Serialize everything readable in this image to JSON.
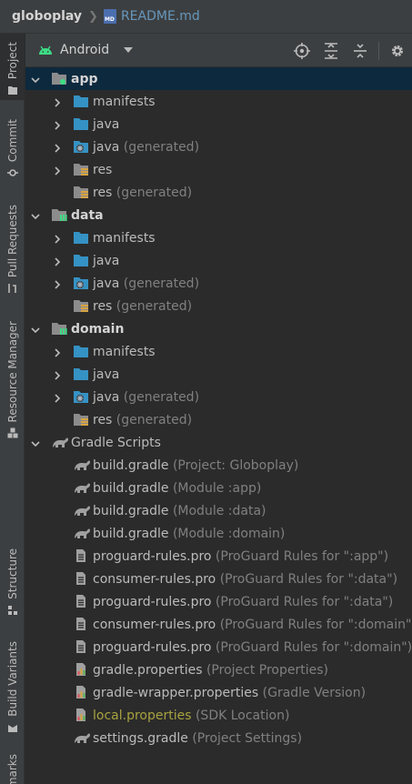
{
  "breadcrumb": {
    "project": "globoplay",
    "file": "README.md"
  },
  "left_tabs": [
    {
      "label": "Project"
    },
    {
      "label": "Commit"
    },
    {
      "label": "Pull Requests"
    },
    {
      "label": "Resource Manager"
    },
    {
      "label": "Structure"
    },
    {
      "label": "Build Variants"
    },
    {
      "label": "Bookmarks"
    }
  ],
  "panel": {
    "view_mode": "Android"
  },
  "tree": [
    {
      "label": "app",
      "hint": "",
      "level": 0,
      "expanded": true,
      "icon": "module-app-icon",
      "selected": true
    },
    {
      "label": "manifests",
      "hint": "",
      "level": 1,
      "expanded": false,
      "icon": "folder-icon"
    },
    {
      "label": "java",
      "hint": "",
      "level": 1,
      "expanded": false,
      "icon": "folder-icon"
    },
    {
      "label": "java",
      "hint": " (generated)",
      "level": 1,
      "expanded": false,
      "icon": "generated-folder-icon"
    },
    {
      "label": "res",
      "hint": "",
      "level": 1,
      "expanded": false,
      "icon": "res-folder-icon"
    },
    {
      "label": "res",
      "hint": " (generated)",
      "level": 1,
      "expanded": null,
      "icon": "res-folder-icon"
    },
    {
      "label": "data",
      "hint": "",
      "level": 0,
      "expanded": true,
      "icon": "module-lib-icon"
    },
    {
      "label": "manifests",
      "hint": "",
      "level": 1,
      "expanded": false,
      "icon": "folder-icon"
    },
    {
      "label": "java",
      "hint": "",
      "level": 1,
      "expanded": false,
      "icon": "folder-icon"
    },
    {
      "label": "java",
      "hint": " (generated)",
      "level": 1,
      "expanded": false,
      "icon": "generated-folder-icon"
    },
    {
      "label": "res",
      "hint": " (generated)",
      "level": 1,
      "expanded": null,
      "icon": "res-folder-icon"
    },
    {
      "label": "domain",
      "hint": "",
      "level": 0,
      "expanded": true,
      "icon": "module-lib-icon"
    },
    {
      "label": "manifests",
      "hint": "",
      "level": 1,
      "expanded": false,
      "icon": "folder-icon"
    },
    {
      "label": "java",
      "hint": "",
      "level": 1,
      "expanded": false,
      "icon": "folder-icon"
    },
    {
      "label": "java",
      "hint": " (generated)",
      "level": 1,
      "expanded": false,
      "icon": "generated-folder-icon"
    },
    {
      "label": "res",
      "hint": " (generated)",
      "level": 1,
      "expanded": null,
      "icon": "res-folder-icon"
    },
    {
      "label": "Gradle Scripts",
      "hint": "",
      "level": 0,
      "expanded": true,
      "icon": "gradle-icon",
      "plain": true
    },
    {
      "label": "build.gradle",
      "hint": " (Project: Globoplay)",
      "level": 1,
      "expanded": null,
      "icon": "gradle-icon"
    },
    {
      "label": "build.gradle",
      "hint": " (Module :app)",
      "level": 1,
      "expanded": null,
      "icon": "gradle-icon"
    },
    {
      "label": "build.gradle",
      "hint": " (Module :data)",
      "level": 1,
      "expanded": null,
      "icon": "gradle-icon"
    },
    {
      "label": "build.gradle",
      "hint": " (Module :domain)",
      "level": 1,
      "expanded": null,
      "icon": "gradle-icon"
    },
    {
      "label": "proguard-rules.pro",
      "hint": " (ProGuard Rules for \":app\")",
      "level": 1,
      "expanded": null,
      "icon": "text-file-icon"
    },
    {
      "label": "consumer-rules.pro",
      "hint": " (ProGuard Rules for \":data\")",
      "level": 1,
      "expanded": null,
      "icon": "text-file-icon"
    },
    {
      "label": "proguard-rules.pro",
      "hint": " (ProGuard Rules for \":data\")",
      "level": 1,
      "expanded": null,
      "icon": "text-file-icon"
    },
    {
      "label": "consumer-rules.pro",
      "hint": " (ProGuard Rules for \":domain\")",
      "level": 1,
      "expanded": null,
      "icon": "text-file-icon"
    },
    {
      "label": "proguard-rules.pro",
      "hint": " (ProGuard Rules for \":domain\")",
      "level": 1,
      "expanded": null,
      "icon": "text-file-icon"
    },
    {
      "label": "gradle.properties",
      "hint": " (Project Properties)",
      "level": 1,
      "expanded": null,
      "icon": "properties-file-icon"
    },
    {
      "label": "gradle-wrapper.properties",
      "hint": " (Gradle Version)",
      "level": 1,
      "expanded": null,
      "icon": "properties-file-icon"
    },
    {
      "label": "local.properties",
      "hint": " (SDK Location)",
      "level": 1,
      "expanded": null,
      "icon": "properties-file-icon",
      "local": true
    },
    {
      "label": "settings.gradle",
      "hint": " (Project Settings)",
      "level": 1,
      "expanded": null,
      "icon": "gradle-icon"
    }
  ],
  "colors": {
    "background": "#2b2b2b",
    "toolbar": "#3c3f41",
    "selection": "#0d293e",
    "folder_blue": "#3592c4",
    "hint_gray": "#808080",
    "local_yellow": "#a8a23f",
    "android_green": "#3ddc84"
  }
}
